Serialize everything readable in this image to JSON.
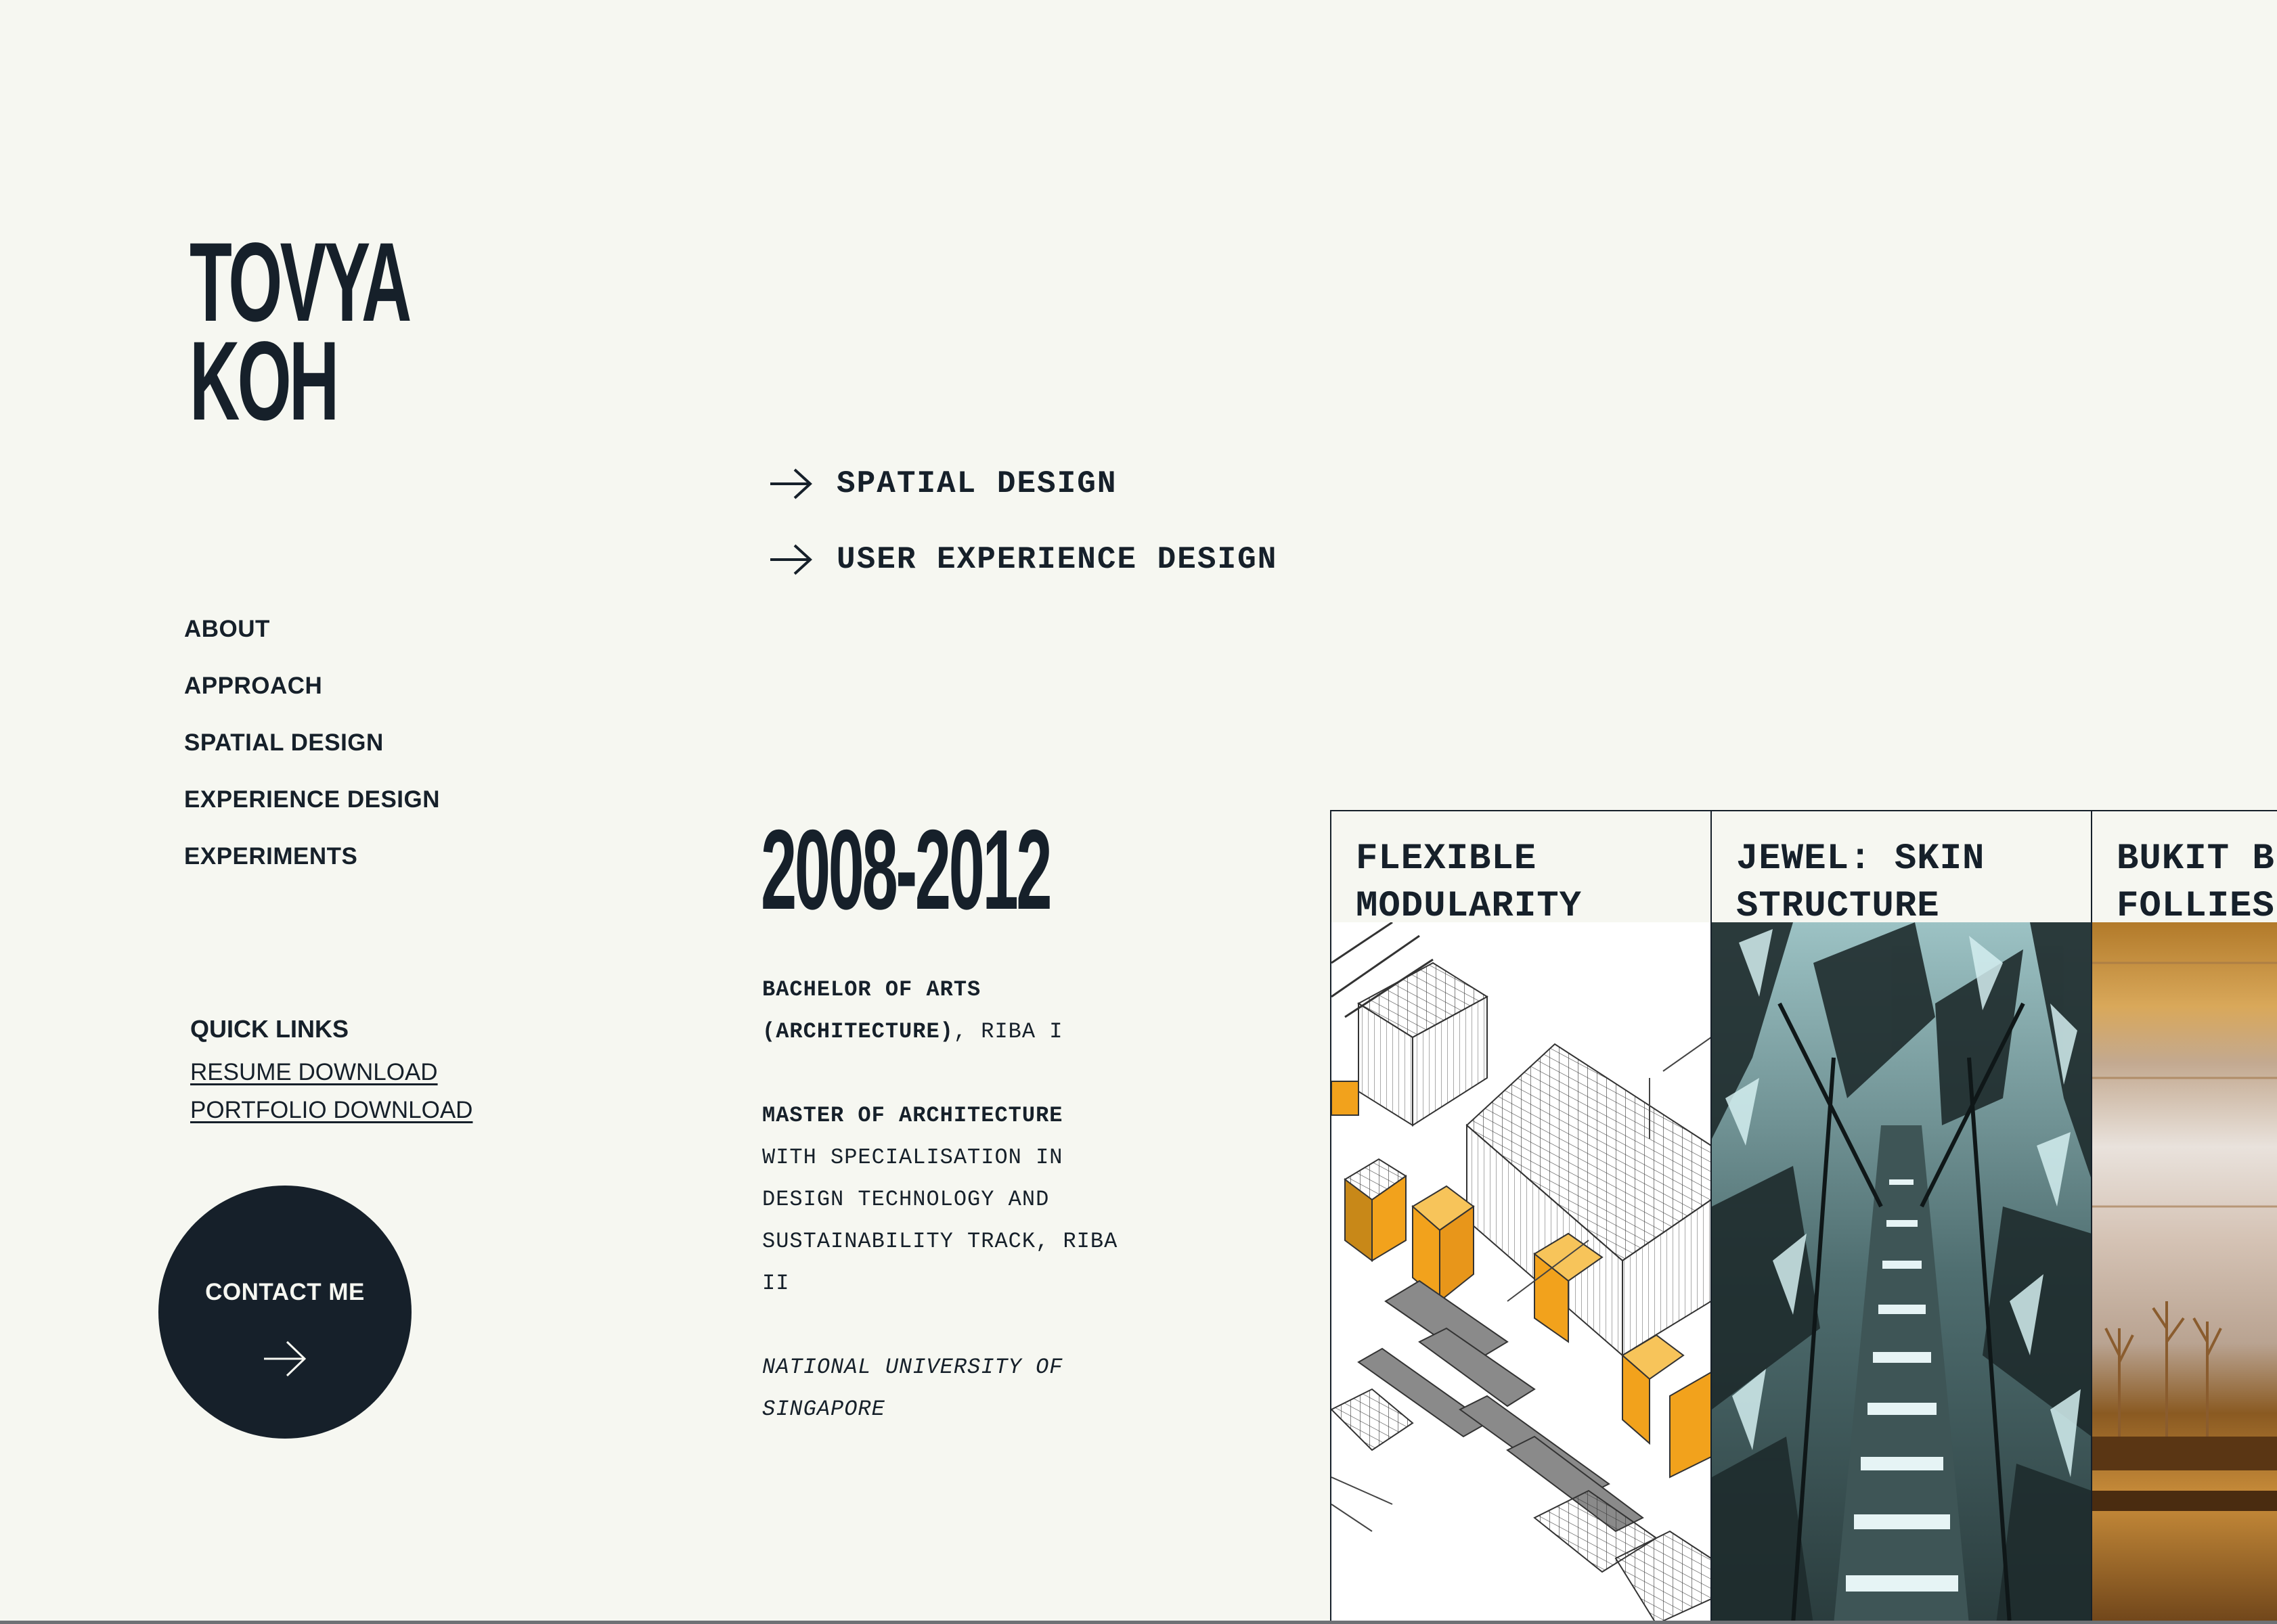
{
  "logo": {
    "line1": "TOVYA",
    "line2": "KOH"
  },
  "services": [
    {
      "label": "SPATIAL DESIGN",
      "icon": "arrow-right-icon"
    },
    {
      "label": "USER EXPERIENCE DESIGN",
      "icon": "arrow-right-icon"
    }
  ],
  "nav": {
    "items": [
      {
        "label": "ABOUT"
      },
      {
        "label": "APPROACH"
      },
      {
        "label": "SPATIAL DESIGN"
      },
      {
        "label": "EXPERIENCE DESIGN"
      },
      {
        "label": "EXPERIMENTS"
      }
    ]
  },
  "quick_links": {
    "title": "QUICK LINKS",
    "resume": "RESUME DOWNLOAD",
    "portfolio": "PORTFOLIO DOWNLOAD"
  },
  "contact": {
    "label": "CONTACT ME",
    "icon": "arrow-right-icon"
  },
  "education": {
    "years": "2008-2012",
    "degree1_bold": "BACHELOR OF ARTS",
    "degree1_line2_bold": "(ARCHITECTURE)",
    "degree1_suffix": ", RIBA I",
    "degree2_bold": "MASTER OF ARCHITECTURE",
    "degree2_rest": "WITH SPECIALISATION IN DESIGN TECHNOLOGY AND SUSTAINABILITY TRACK, RIBA II",
    "school": "NATIONAL UNIVERSITY OF SINGAPORE"
  },
  "projects": [
    {
      "title_line1": "FLEXIBLE",
      "title_line2": "MODULARITY",
      "image": "isometric-modular-drawing"
    },
    {
      "title_line1": "JEWEL: SKIN",
      "title_line2": "STRUCTURE",
      "image": "glass-structure-render"
    },
    {
      "title_line1": "BUKIT B",
      "title_line2": "FOLLIES",
      "image": "wooden-model-photo"
    }
  ],
  "colors": {
    "background": "#f6f7f1",
    "ink": "#16202a",
    "accent_orange": "#f2a21c",
    "teal_dark": "#2f4546"
  }
}
